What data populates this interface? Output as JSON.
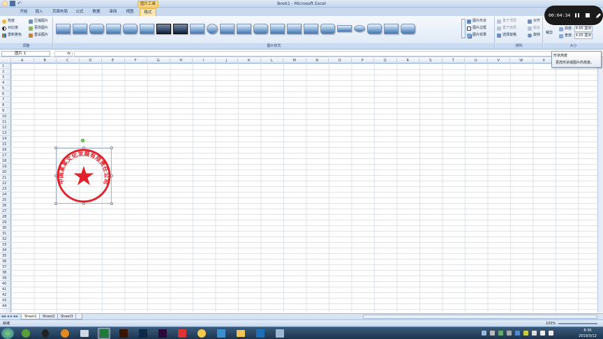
{
  "window": {
    "title": "Book1 - Microsoft Excel",
    "context_tab_group": "图片工具"
  },
  "tabs": [
    {
      "label": "开始"
    },
    {
      "label": "插入"
    },
    {
      "label": "页面布局"
    },
    {
      "label": "公式"
    },
    {
      "label": "数据"
    },
    {
      "label": "审阅"
    },
    {
      "label": "视图"
    },
    {
      "label": "格式"
    }
  ],
  "ribbon": {
    "adjust": {
      "label": "调整",
      "brightness": "亮度",
      "contrast": "对比度",
      "recolor": "重新着色",
      "compress": "压缩图片",
      "change": "更改图片",
      "reset": "重设图片"
    },
    "styles": {
      "label": "图片样式",
      "shape": "图片形状",
      "border": "图片边框",
      "effects": "图片效果"
    },
    "arrange": {
      "label": "排列",
      "front": "置于顶层",
      "back": "置于底层",
      "pane": "选择窗格",
      "align": "对齐",
      "group": "组合",
      "rotate": "旋转"
    },
    "size": {
      "label": "大小",
      "crop": "裁剪",
      "height_label": "高度:",
      "height": "4.65 厘米",
      "width_label": "宽度:",
      "width": "4.65 厘米"
    }
  },
  "tooltip": {
    "title": "形状高度",
    "body": "更改形状或图片的高度。"
  },
  "recorder": {
    "time": "00:04:34"
  },
  "formula_bar": {
    "name_box": "图片 1",
    "fx": "fx"
  },
  "columns": [
    "A",
    "B",
    "C",
    "D",
    "E",
    "F",
    "G",
    "H",
    "I",
    "J",
    "K",
    "L",
    "M",
    "N",
    "O",
    "P",
    "Q",
    "R",
    "S",
    "T",
    "U",
    "V",
    "W",
    "X"
  ],
  "rows": [
    "1",
    "2",
    "3",
    "4",
    "5",
    "6",
    "7",
    "8",
    "9",
    "10",
    "11",
    "12",
    "13",
    "14",
    "15",
    "16",
    "17",
    "18",
    "19",
    "20",
    "21",
    "22",
    "23",
    "24",
    "25",
    "26",
    "27",
    "28",
    "29",
    "30",
    "31",
    "32",
    "33",
    "34",
    "35",
    "36",
    "37",
    "38",
    "39",
    "40",
    "41",
    "42",
    "43",
    "44"
  ],
  "stamp": {
    "text": "中国某某文化发展有限责任公司",
    "color": "#e0232a"
  },
  "sheets": [
    "Sheet1",
    "Sheet2",
    "Sheet3"
  ],
  "status": {
    "ready": "就绪",
    "zoom": "100%"
  },
  "taskbar": {
    "time": "8:36",
    "date": "2019/3/12"
  }
}
